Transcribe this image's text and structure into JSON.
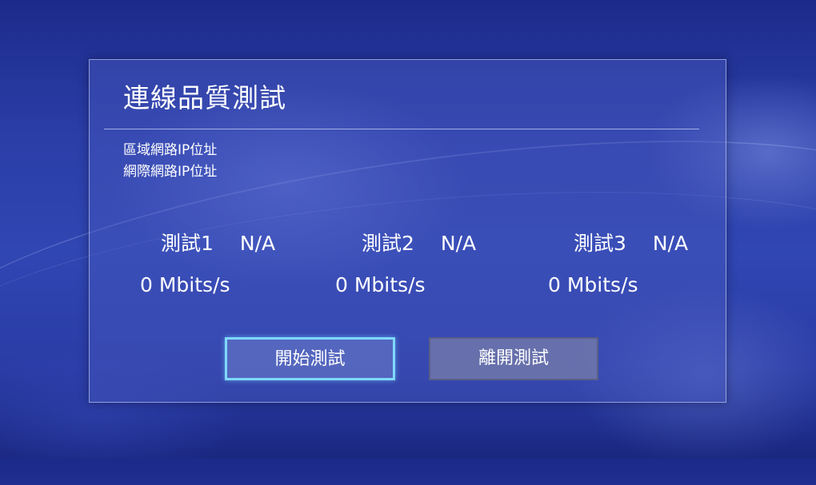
{
  "dialog": {
    "title": "連線品質測試",
    "lan_ip_label": "區域網路IP位址",
    "wan_ip_label": "網際網路IP位址"
  },
  "tests": [
    {
      "label": "測試1",
      "status": "N/A",
      "speed": "0 Mbits/s"
    },
    {
      "label": "測試2",
      "status": "N/A",
      "speed": "0 Mbits/s"
    },
    {
      "label": "測試3",
      "status": "N/A",
      "speed": "0 Mbits/s"
    }
  ],
  "buttons": {
    "start_label": "開始測試",
    "exit_label": "離開測試"
  },
  "colors": {
    "background": "#2b3ea8",
    "focus_border": "#7fd8ff",
    "text": "#ffffff"
  }
}
